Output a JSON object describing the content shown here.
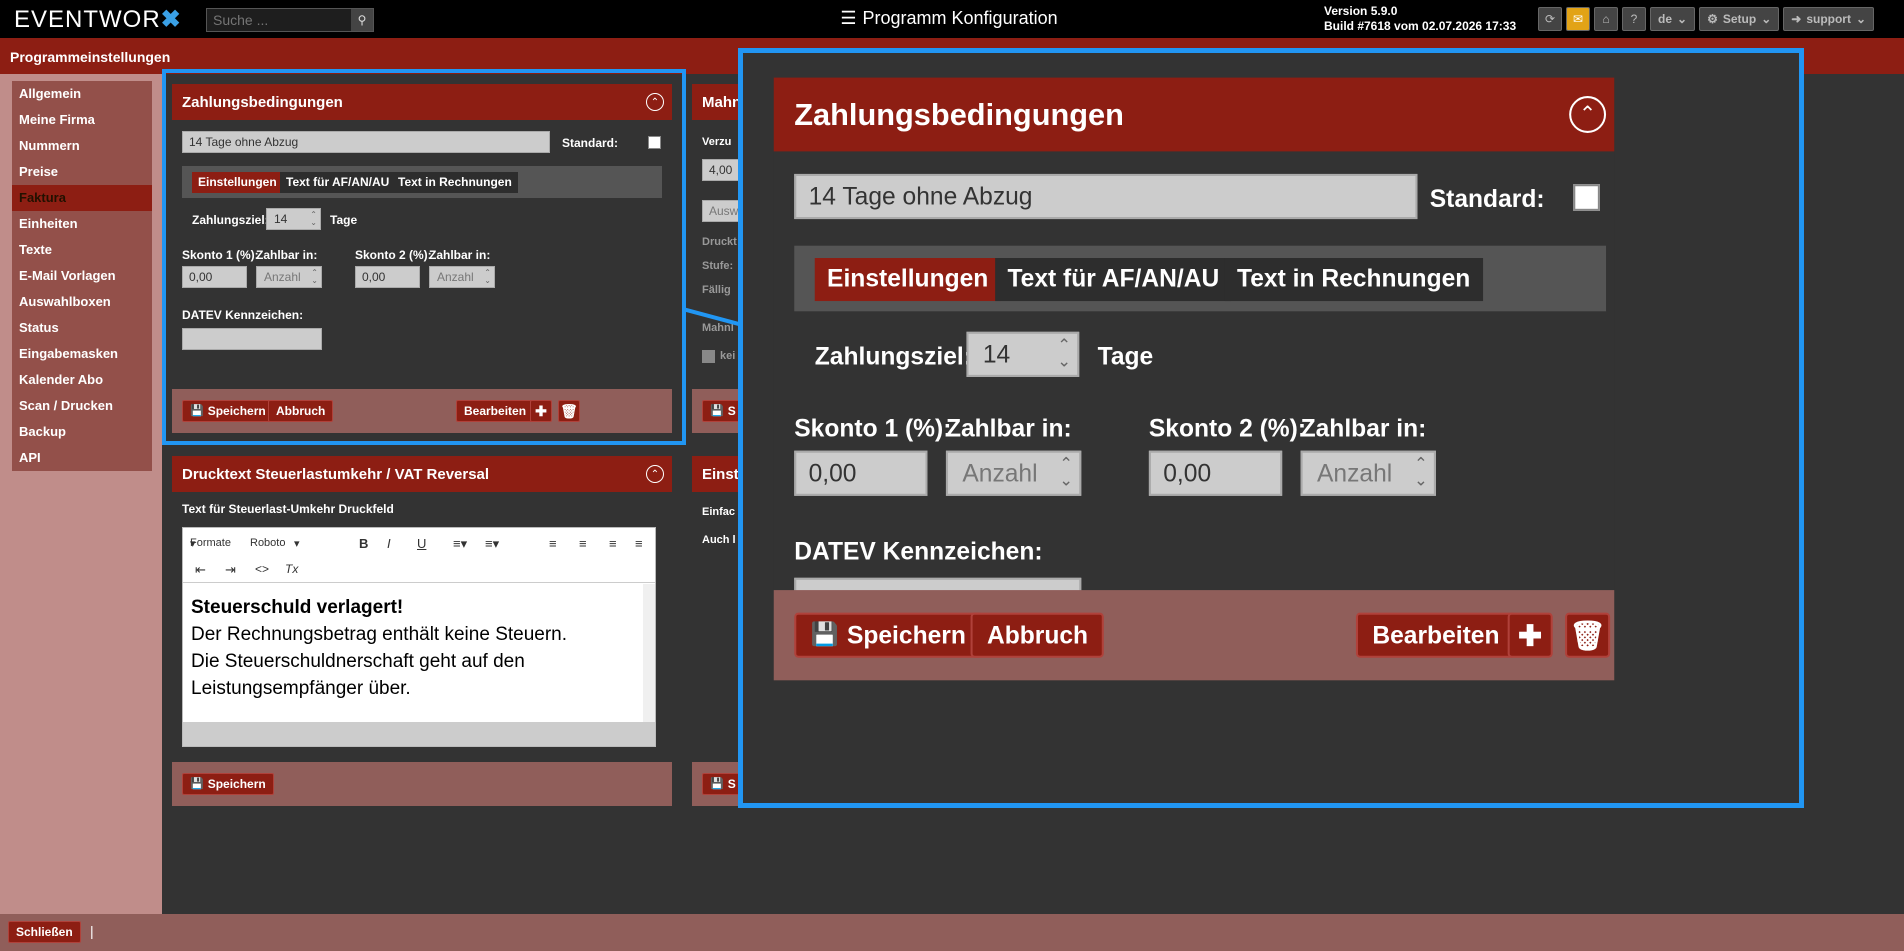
{
  "topbar": {
    "logo": "EVENTWOR",
    "logo_x": "✖",
    "search_placeholder": "Suche ...",
    "title": "Programm Konfiguration",
    "version_line1": "Version 5.9.0",
    "version_line2": "Build #7618 vom 02.07.2026 17:33",
    "lang": "de",
    "setup": "Setup",
    "user": "support",
    "help": "?"
  },
  "section_title": "Programmeinstellungen",
  "sidebar": {
    "items": [
      "Allgemein",
      "Meine Firma",
      "Nummern",
      "Preise",
      "Faktura",
      "Einheiten",
      "Texte",
      "E-Mail Vorlagen",
      "Auswahlboxen",
      "Status",
      "Eingabemasken",
      "Kalender Abo",
      "Scan / Drucken",
      "Backup",
      "API"
    ],
    "active": "Faktura"
  },
  "payment": {
    "title": "Zahlungsbedingungen",
    "name_value": "14 Tage ohne Abzug",
    "standard_label": "Standard:",
    "tabs": [
      "Einstellungen",
      "Text für AF/AN/AU",
      "Text in Rechnungen"
    ],
    "zahlungsziel_label": "Zahlungsziel:",
    "zahlungsziel_value": "14",
    "tage": "Tage",
    "skonto1_label": "Skonto 1 (%):",
    "skonto1_value": "0,00",
    "zahlbar1_label": "Zahlbar in:",
    "zahlbar1_value": "Anzahl",
    "skonto2_label": "Skonto 2 (%):",
    "skonto2_value": "0,00",
    "zahlbar2_label": "Zahlbar in:",
    "zahlbar2_value": "Anzahl",
    "datev_label": "DATEV Kennzeichen:",
    "datev_value": "",
    "save": "Speichern",
    "cancel": "Abbruch",
    "edit": "Bearbeiten"
  },
  "vat": {
    "title": "Drucktext Steuerlastumkehr / VAT Reversal",
    "field_label": "Text für Steuerlast-Umkehr Druckfeld",
    "toolbar_format": "Formate",
    "toolbar_font": "Roboto",
    "content_bold": "Steuerschuld verlagert!",
    "content_line1": "Der Rechnungsbetrag enthält keine Steuern.",
    "content_line2": "Die Steuerschuldnerschaft geht auf den",
    "content_line3": "Leistungsempfänger über.",
    "save": "Speichern"
  },
  "mahn": {
    "title_partial": "Mahn",
    "verzug_label": "Verzu",
    "verzug_value": "4,00",
    "ausw_value": "Ausw",
    "druck_label": "Druckt",
    "stufe_label": "Stufe:",
    "faellig_label": "Fällig",
    "mahnl_label": "Mahnl",
    "kei_label": "kei",
    "save_partial": "S"
  },
  "einst": {
    "title_partial": "Einste",
    "einfac_label": "Einfac",
    "auch_label": "Auch l",
    "save_partial": "S"
  },
  "bottom": {
    "close": "Schließen",
    "sep": "|"
  },
  "colors": {
    "brand_red": "#8d1e13",
    "highlight_blue": "#2196f3",
    "mail_yellow": "#e2a316"
  }
}
